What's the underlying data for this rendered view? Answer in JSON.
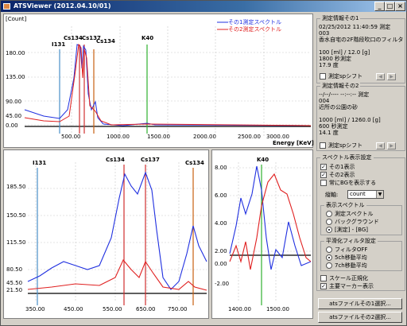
{
  "window": {
    "title": "ATSViewer (2012.04.10/01)"
  },
  "top_chart": {
    "ylabel": "[Count]",
    "xlabel": "Energy [KeV]",
    "yticks": [
      "180.00",
      "135.00",
      "90.00",
      "45.00",
      "0.00"
    ],
    "xticks": [
      "500.00",
      "1000.00",
      "1500.00",
      "2000.00",
      "2500.00",
      "3000.00"
    ],
    "legend": [
      "その1測定スペクトル",
      "その2測定スペクトル"
    ],
    "markers": [
      "I131",
      "Cs134",
      "Cs137",
      "Cs134",
      "K40"
    ]
  },
  "left_chart": {
    "yticks": [
      "185.50",
      "150.50",
      "115.50",
      "80.50",
      "45.50",
      "21.50"
    ],
    "xticks": [
      "350.00",
      "450.00",
      "550.00",
      "650.00",
      "750.00"
    ],
    "markers": [
      "I131",
      "Cs134",
      "Cs137",
      "Cs134"
    ]
  },
  "right_chart": {
    "yticks": [
      "8.00",
      "6.00",
      "4.00",
      "2.00",
      "0.00",
      "-2.00"
    ],
    "xticks": [
      "1400.00",
      "1500.00"
    ],
    "markers": [
      "K40"
    ]
  },
  "info1": {
    "title": "測定情報その1",
    "lines": [
      "02/25/2012 11:40:59 測定",
      "003",
      "香水自宅の2F階段吹口のフィルタ",
      "",
      "100 [ml] / 12.0 [g]",
      "1800 秒測定",
      "17.9 度"
    ],
    "shift_label": "測定spシフト"
  },
  "info2": {
    "title": "測定情報その2",
    "lines": [
      "--/--/---- --:--:-- 測定",
      "004",
      "近所の公園の砂",
      "",
      "1000 [ml] / 1260.0 [g]",
      "600 秒測定",
      "14.1 度"
    ],
    "shift_label": "測定spシフト"
  },
  "display_settings": {
    "title": "スペクトル表示設定",
    "show1": "その1表示",
    "show2": "その2表示",
    "bg_label": "常にBGを表示する",
    "axis_label": "縦軸:",
    "axis_value": "count"
  },
  "spectrum_group": {
    "title": "表示スペクトル",
    "options": [
      "測定スペクトル",
      "バックグラウンド",
      "[測定] - [BG]"
    ],
    "selected": 2
  },
  "smoothing_group": {
    "title": "平滑化フィルタ設定",
    "options": [
      "フィルタOFF",
      "5ch移動平均",
      "7ch移動平均"
    ],
    "selected": 1
  },
  "scale_label": "スケール正規化",
  "marker_label": "主要マーカー表示",
  "buttons": {
    "select1": "atsファイルその1選択...",
    "select2": "atsファイルその2選択..."
  }
}
